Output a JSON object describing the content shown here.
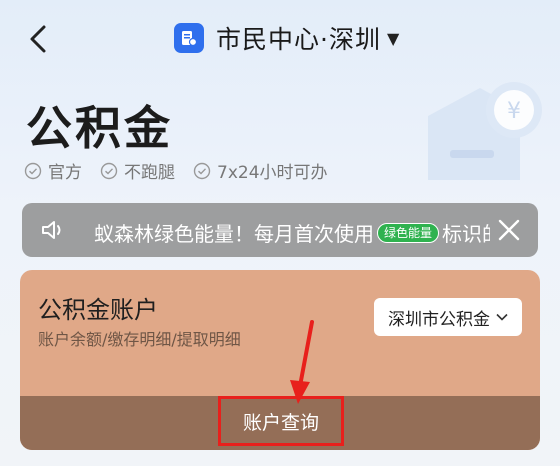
{
  "nav": {
    "title": "市民中心·深圳",
    "logo_icon": "document-card-icon",
    "accent": "#2f6fed"
  },
  "hero": {
    "title": "公积金",
    "tags": [
      "官方",
      "不跑腿",
      "7x24小时可办"
    ]
  },
  "notice": {
    "text_before": "蚁森林绿色能量！每月首次使用",
    "badge": "绿色能量",
    "text_after": "标识的"
  },
  "card": {
    "title": "公积金账户",
    "subtitle": "账户余额/缴存明细/提取明细",
    "city_select": "深圳市公积金",
    "query_button": "账户查询",
    "highlight_color": "#e8201c"
  }
}
